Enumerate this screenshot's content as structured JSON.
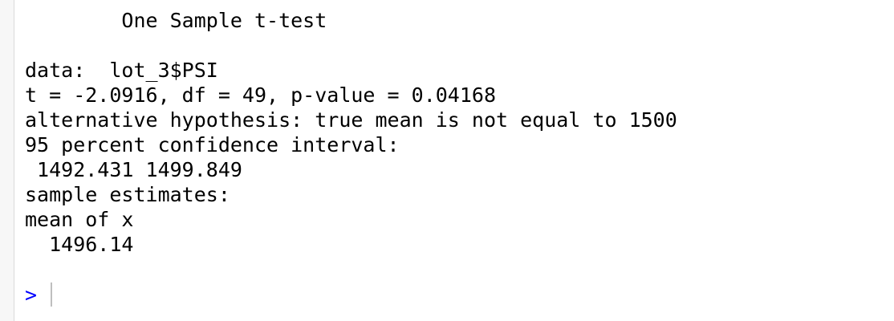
{
  "console": {
    "lines": [
      "        One Sample t-test",
      "",
      "data:  lot_3$PSI",
      "t = -2.0916, df = 49, p-value = 0.04168",
      "alternative hypothesis: true mean is not equal to 1500",
      "95 percent confidence interval:",
      " 1492.431 1499.849",
      "sample estimates:",
      "mean of x",
      "  1496.14"
    ],
    "prompt": ">",
    "colors": {
      "text": "#000000",
      "prompt": "#0000ff",
      "background": "#ffffff"
    }
  }
}
